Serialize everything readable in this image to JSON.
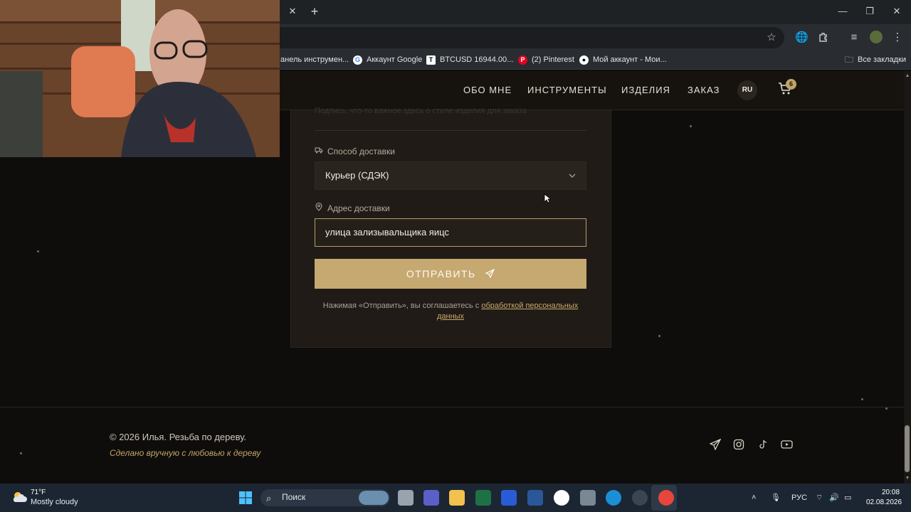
{
  "browser": {
    "bookmarks": [
      {
        "label": "анель инструмен...",
        "icon": "tab-icon"
      },
      {
        "label": "Аккаунт Google",
        "icon": "google-icon"
      },
      {
        "label": "BTCUSD 16944.00...",
        "icon": "tradingview-icon"
      },
      {
        "label": "(2) Pinterest",
        "icon": "pinterest-icon"
      },
      {
        "label": "Мой аккаунт - Мои...",
        "icon": "account-icon"
      }
    ],
    "all_bookmarks": "Все закладки"
  },
  "site": {
    "nav": [
      "ОБО МНЕ",
      "ИНСТРУМЕНТЫ",
      "ИЗДЕЛИЯ",
      "ЗАКАЗ"
    ],
    "lang": "RU",
    "cart_count": "6",
    "accent_color": "#c5a971"
  },
  "form": {
    "faded_top_text": "Подпись, что-то важное здесь о стиле изделия для заказа",
    "delivery_label": "Способ доставки",
    "delivery_value": "Курьер (СДЭК)",
    "address_label": "Адрес доставки",
    "address_value": "улица зализывальщика яицс",
    "submit_label": "ОТПРАВИТЬ",
    "consent_text": "Нажимая «Отправить», вы соглашаетесь с ",
    "consent_link": "обработкой персональных данных"
  },
  "footer": {
    "copyright": "© 2026 Илья. Резьба по дереву.",
    "tagline": "Сделано вручную с любовью к дереву",
    "socials": [
      "telegram-icon",
      "instagram-icon",
      "tiktok-icon",
      "youtube-icon"
    ]
  },
  "taskbar": {
    "weather_temp": "71°F",
    "weather_desc": "Mostly cloudy",
    "search_placeholder": "Поиск",
    "lang_indicator": "РУС",
    "time": "20:08",
    "date": "02.08.2026"
  }
}
